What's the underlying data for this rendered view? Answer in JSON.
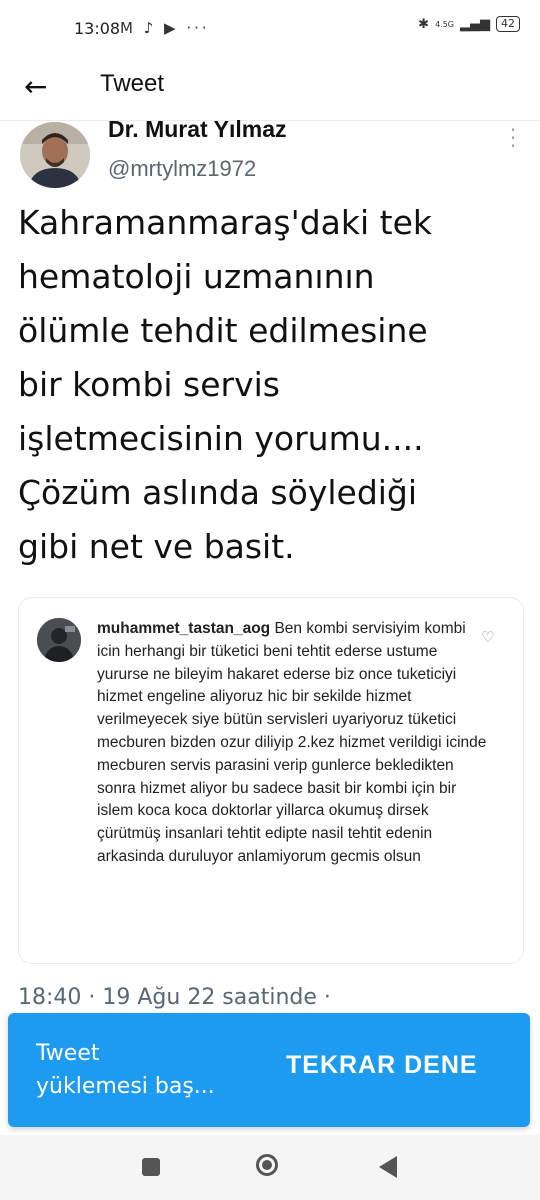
{
  "status_bar": {
    "time": "13:08",
    "left_icons": "M ♪ ▶ ···",
    "network": "4.5G",
    "battery": "42"
  },
  "topbar": {
    "back_icon": "arrow-left-icon",
    "title": "Tweet"
  },
  "tweet": {
    "author_name": "Dr. Murat Yılmaz",
    "author_handle": "@mrtylmz1972",
    "text": "Kahramanmaraş'daki tek\nhematoloji uzmanının\nölümle tehdit edilmesine\nbir kombi servis\nişletmecisinin yorumu....\nÇözüm aslında söylediği\ngibi net ve basit.",
    "timestamp": "18:40 · 19 Ağu 22 saatinde ·"
  },
  "quoted_comment": {
    "username": "muhammet_tastan_aog",
    "text": "Ben kombi servisiyim kombi icin herhangi bir tüketici beni tehtit ederse ustume yururse ne bileyim hakaret ederse biz once tuketiciyi hizmet engeline aliyoruz hic bir sekilde hizmet verilmeyecek siye bütün servisleri uyariyoruz tüketici mecburen bizden ozur diliyip 2.kez hizmet verildigi icinde mecburen servis parasini verip gunlerce bekledikten sonra hizmet aliyor bu sadece basit bir kombi için bir islem koca koca doktorlar yillarca okumuş dirsek çürütmüş insanlari tehtit edipte nasil tehtit edenin arkasinda duruluyor anlamiyorum gecmis olsun"
  },
  "snackbar": {
    "message": "Tweet\nyüklemesi baş...",
    "action": "TEKRAR DENE",
    "color": "#1d9bf0"
  },
  "nav_bar": {
    "icons": [
      "square-icon",
      "home-circle-icon",
      "back-triangle-icon"
    ]
  }
}
